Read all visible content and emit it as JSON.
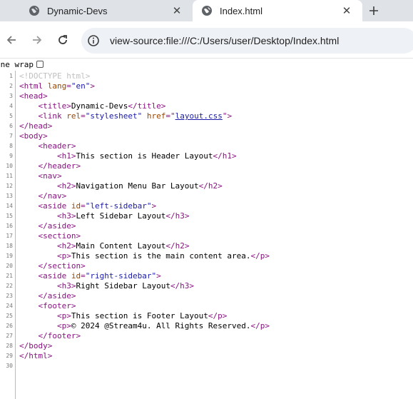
{
  "tabs": [
    {
      "title": "Dynamic-Devs",
      "active": false
    },
    {
      "title": "Index.html",
      "active": true
    }
  ],
  "address_bar": {
    "url": "view-source:file:///C:/Users/user/Desktop/Index.html"
  },
  "line_wrap_label": "ine wrap",
  "colors": {
    "tag": "#881280",
    "attr": "#994500",
    "value": "#1a1aa6",
    "doctype": "#c0c0c0"
  },
  "source_lines": [
    {
      "n": "1",
      "indent": "",
      "parts": [
        [
          "doctype",
          "<!DOCTYPE html>"
        ]
      ]
    },
    {
      "n": "2",
      "indent": "",
      "parts": [
        [
          "tag",
          "<html "
        ],
        [
          "attr",
          "lang"
        ],
        [
          "tag",
          "="
        ],
        [
          "val",
          "\"en\""
        ],
        [
          "tag",
          ">"
        ]
      ]
    },
    {
      "n": "3",
      "indent": "",
      "parts": [
        [
          "tag",
          "<head>"
        ]
      ]
    },
    {
      "n": "4",
      "indent": "    ",
      "parts": [
        [
          "tag",
          "<title>"
        ],
        [
          "text",
          "Dynamic-Devs"
        ],
        [
          "tag",
          "</title>"
        ]
      ]
    },
    {
      "n": "5",
      "indent": "    ",
      "parts": [
        [
          "tag",
          "<link "
        ],
        [
          "attr",
          "rel"
        ],
        [
          "tag",
          "="
        ],
        [
          "val",
          "\"stylesheet\""
        ],
        [
          "text",
          " "
        ],
        [
          "attr",
          "href"
        ],
        [
          "tag",
          "=\""
        ],
        [
          "link",
          "layout.css"
        ],
        [
          "tag",
          "\">"
        ]
      ]
    },
    {
      "n": "6",
      "indent": "",
      "parts": [
        [
          "tag",
          "</head>"
        ]
      ]
    },
    {
      "n": "7",
      "indent": "",
      "parts": [
        [
          "tag",
          "<body>"
        ]
      ]
    },
    {
      "n": "8",
      "indent": "    ",
      "parts": [
        [
          "tag",
          "<header>"
        ]
      ]
    },
    {
      "n": "9",
      "indent": "        ",
      "parts": [
        [
          "tag",
          "<h1>"
        ],
        [
          "text",
          "This section is Header Layout"
        ],
        [
          "tag",
          "</h1>"
        ]
      ]
    },
    {
      "n": "10",
      "indent": "    ",
      "parts": [
        [
          "tag",
          "</header>"
        ]
      ]
    },
    {
      "n": "11",
      "indent": "    ",
      "parts": [
        [
          "tag",
          "<nav>"
        ]
      ]
    },
    {
      "n": "12",
      "indent": "        ",
      "parts": [
        [
          "tag",
          "<h2>"
        ],
        [
          "text",
          "Navigation Menu Bar Layout"
        ],
        [
          "tag",
          "</h2>"
        ]
      ]
    },
    {
      "n": "13",
      "indent": "    ",
      "parts": [
        [
          "tag",
          "</nav>"
        ]
      ]
    },
    {
      "n": "14",
      "indent": "    ",
      "parts": [
        [
          "tag",
          "<aside "
        ],
        [
          "attr",
          "id"
        ],
        [
          "tag",
          "="
        ],
        [
          "val",
          "\"left-sidebar\""
        ],
        [
          "tag",
          ">"
        ]
      ]
    },
    {
      "n": "15",
      "indent": "        ",
      "parts": [
        [
          "tag",
          "<h3>"
        ],
        [
          "text",
          "Left Sidebar Layout"
        ],
        [
          "tag",
          "</h3>"
        ]
      ]
    },
    {
      "n": "16",
      "indent": "    ",
      "parts": [
        [
          "tag",
          "</aside>"
        ]
      ]
    },
    {
      "n": "17",
      "indent": "    ",
      "parts": [
        [
          "tag",
          "<section>"
        ]
      ]
    },
    {
      "n": "18",
      "indent": "        ",
      "parts": [
        [
          "tag",
          "<h2>"
        ],
        [
          "text",
          "Main Content Layout"
        ],
        [
          "tag",
          "</h2>"
        ]
      ]
    },
    {
      "n": "19",
      "indent": "        ",
      "parts": [
        [
          "tag",
          "<p>"
        ],
        [
          "text",
          "This section is the main content area."
        ],
        [
          "tag",
          "</p>"
        ]
      ]
    },
    {
      "n": "20",
      "indent": "    ",
      "parts": [
        [
          "tag",
          "</section>"
        ]
      ]
    },
    {
      "n": "21",
      "indent": "    ",
      "parts": [
        [
          "tag",
          "<aside "
        ],
        [
          "attr",
          "id"
        ],
        [
          "tag",
          "="
        ],
        [
          "val",
          "\"right-sidebar\""
        ],
        [
          "tag",
          ">"
        ]
      ]
    },
    {
      "n": "22",
      "indent": "        ",
      "parts": [
        [
          "tag",
          "<h3>"
        ],
        [
          "text",
          "Right Sidebar Layout"
        ],
        [
          "tag",
          "</h3>"
        ]
      ]
    },
    {
      "n": "23",
      "indent": "    ",
      "parts": [
        [
          "tag",
          "</aside>"
        ]
      ]
    },
    {
      "n": "24",
      "indent": "    ",
      "parts": [
        [
          "tag",
          "<footer>"
        ]
      ]
    },
    {
      "n": "25",
      "indent": "        ",
      "parts": [
        [
          "tag",
          "<p>"
        ],
        [
          "text",
          "This section is Footer Layout"
        ],
        [
          "tag",
          "</p>"
        ]
      ]
    },
    {
      "n": "26",
      "indent": "        ",
      "parts": [
        [
          "tag",
          "<p>"
        ],
        [
          "text",
          "© 2024 @Stream4u. All Rights Reserved."
        ],
        [
          "tag",
          "</p>"
        ]
      ]
    },
    {
      "n": "27",
      "indent": "    ",
      "parts": [
        [
          "tag",
          "</footer>"
        ]
      ]
    },
    {
      "n": "28",
      "indent": "",
      "parts": [
        [
          "tag",
          "</body>"
        ]
      ]
    },
    {
      "n": "29",
      "indent": "",
      "parts": [
        [
          "tag",
          "</html>"
        ]
      ]
    },
    {
      "n": "30",
      "indent": "",
      "parts": []
    }
  ]
}
